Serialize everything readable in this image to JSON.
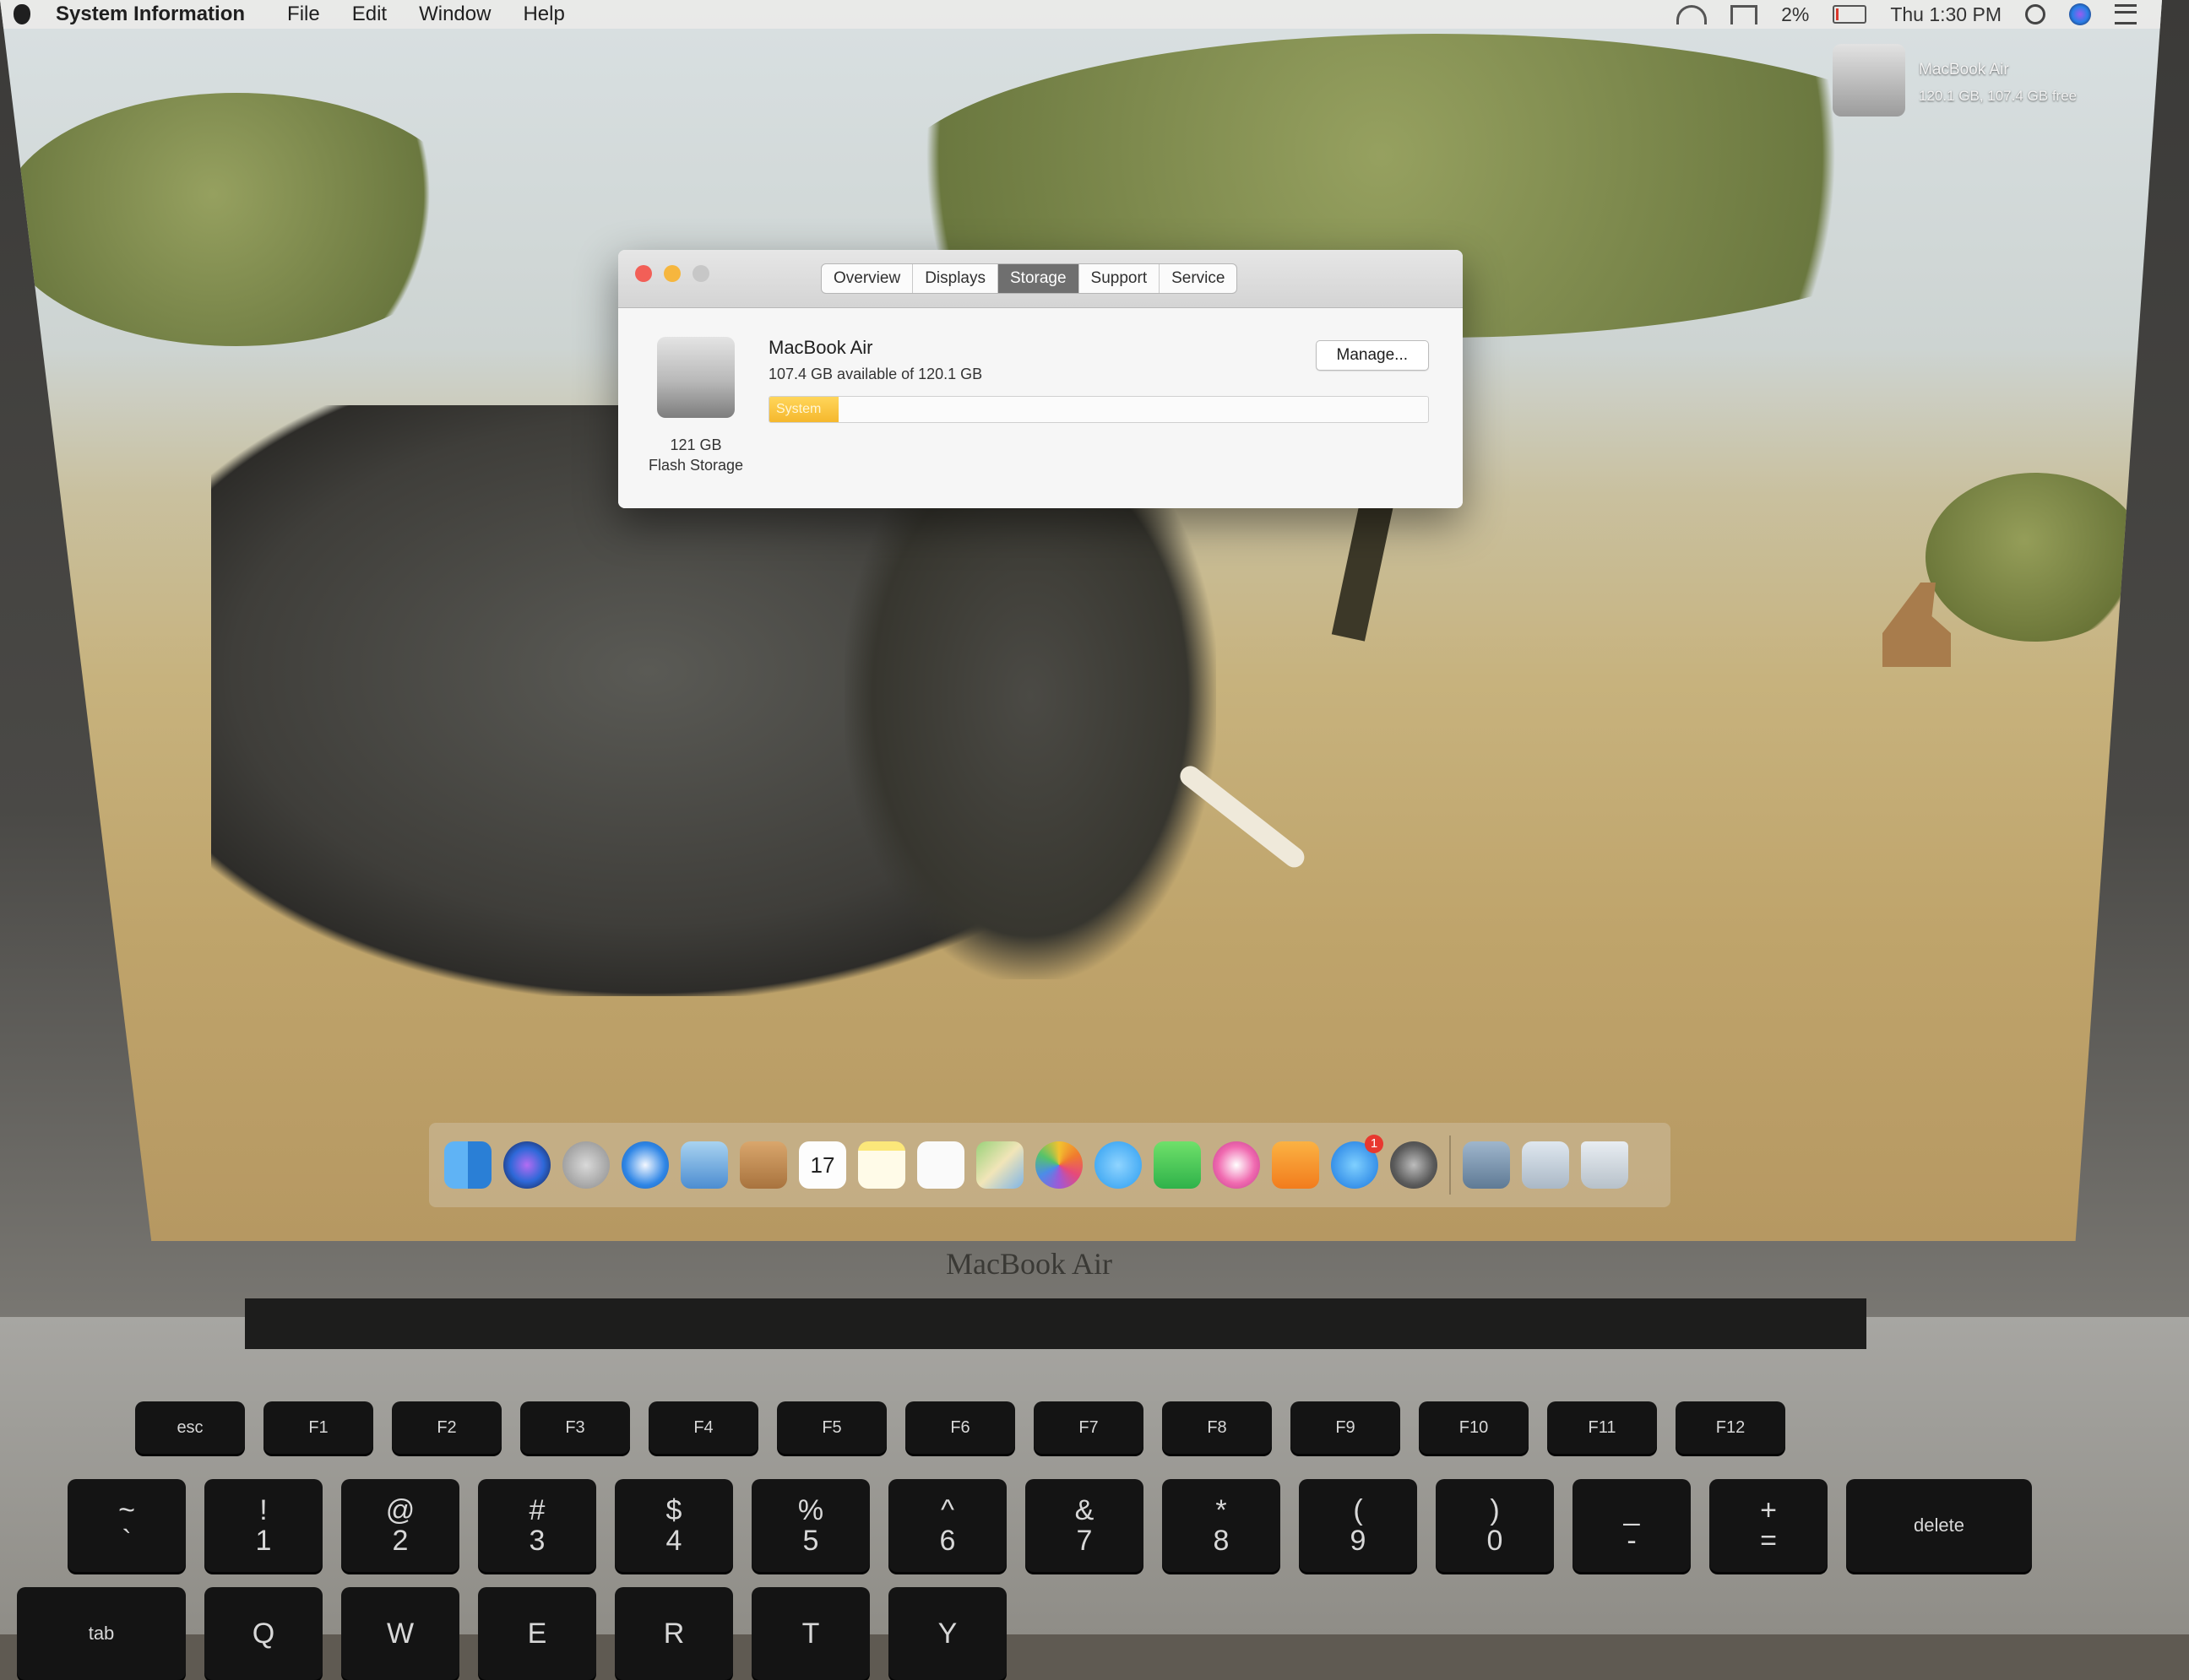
{
  "menubar": {
    "app_name": "System Information",
    "items": [
      "File",
      "Edit",
      "Window",
      "Help"
    ],
    "battery_percent": "2%",
    "clock": "Thu 1:30 PM"
  },
  "desktop": {
    "drive_name": "MacBook Air",
    "drive_info": "120.1 GB, 107.4 GB free"
  },
  "window": {
    "tabs": [
      "Overview",
      "Displays",
      "Storage",
      "Support",
      "Service"
    ],
    "active_tab": "Storage",
    "drive": {
      "name": "MacBook Air",
      "available": "107.4 GB available of 120.1 GB",
      "capacity": "121 GB",
      "type": "Flash Storage",
      "manage_label": "Manage...",
      "segments": [
        {
          "label": "System",
          "fraction": 0.105,
          "color": "#f5b82d"
        }
      ]
    }
  },
  "dock": {
    "icons": [
      "finder-icon",
      "siri-icon",
      "launchpad-icon",
      "safari-icon",
      "mail-icon",
      "contacts-icon",
      "calendar-icon",
      "notes-icon",
      "reminders-icon",
      "maps-icon",
      "photos-icon",
      "messages-icon",
      "facetime-icon",
      "itunes-icon",
      "ibooks-icon",
      "app-store-icon",
      "system-preferences-icon",
      "downloads-icon",
      "documents-icon",
      "trash-icon"
    ],
    "calendar_date": "17",
    "app_store_badge": "1"
  },
  "laptop": {
    "model_label": "MacBook Air"
  },
  "keyboard": {
    "function_row": [
      "esc",
      "F1",
      "F2",
      "F3",
      "F4",
      "F5",
      "F6",
      "F7",
      "F8",
      "F9",
      "F10",
      "F11",
      "F12"
    ],
    "number_row": [
      {
        "top": "~",
        "bottom": "`"
      },
      {
        "top": "!",
        "bottom": "1"
      },
      {
        "top": "@",
        "bottom": "2"
      },
      {
        "top": "#",
        "bottom": "3"
      },
      {
        "top": "$",
        "bottom": "4"
      },
      {
        "top": "%",
        "bottom": "5"
      },
      {
        "top": "^",
        "bottom": "6"
      },
      {
        "top": "&",
        "bottom": "7"
      },
      {
        "top": "*",
        "bottom": "8"
      },
      {
        "top": "(",
        "bottom": "9"
      },
      {
        "top": ")",
        "bottom": "0"
      },
      {
        "top": "_",
        "bottom": "-"
      },
      {
        "top": "+",
        "bottom": "="
      },
      {
        "top": "",
        "bottom": "delete"
      }
    ],
    "letter_row": [
      "tab",
      "Q",
      "W",
      "E",
      "R",
      "T",
      "Y"
    ]
  },
  "colors": {
    "close": "#f25f57",
    "minimize": "#f6b63e",
    "tab_active": "#6f6f6f",
    "system_segment": "#f5b82d"
  }
}
